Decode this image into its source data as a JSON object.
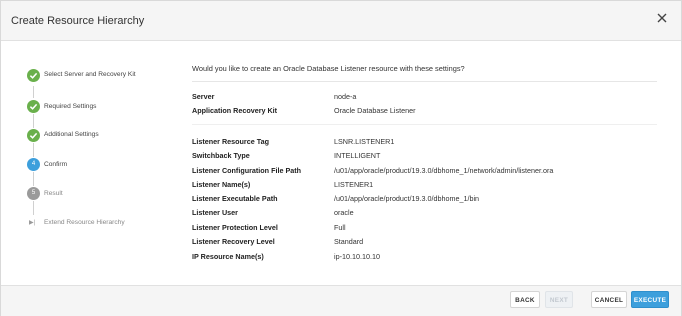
{
  "dialog": {
    "title": "Create Resource Hierarchy",
    "close_icon": "close-icon"
  },
  "steps": [
    {
      "label": "Select Server and Recovery Kit",
      "state": "done",
      "icon": "check-circle-icon"
    },
    {
      "label": "Required Settings",
      "state": "done",
      "icon": "check-circle-icon"
    },
    {
      "label": "Additional Settings",
      "state": "done",
      "icon": "check-circle-icon"
    },
    {
      "label": "Confirm",
      "state": "current",
      "number": "4",
      "icon": "step-number-icon"
    },
    {
      "label": "Result",
      "state": "pending",
      "number": "5",
      "icon": "step-number-icon"
    },
    {
      "label": "Extend Resource Hierarchy",
      "state": "pending",
      "icon": "arrow-icon",
      "arrow": "▶|"
    }
  ],
  "content": {
    "question": "Would you like to create an Oracle Database Listener resource with these settings?",
    "summary": [
      {
        "key": "Server",
        "value": "node-a"
      },
      {
        "key": "Application Recovery Kit",
        "value": "Oracle Database Listener"
      }
    ],
    "settings": [
      {
        "key": "Listener Resource Tag",
        "value": "LSNR.LISTENER1"
      },
      {
        "key": "Switchback Type",
        "value": "INTELLIGENT"
      },
      {
        "key": "Listener Configuration File Path",
        "value": "/u01/app/oracle/product/19.3.0/dbhome_1/network/admin/listener.ora"
      },
      {
        "key": "Listener Name(s)",
        "value": "LISTENER1"
      },
      {
        "key": "Listener Executable Path",
        "value": "/u01/app/oracle/product/19.3.0/dbhome_1/bin"
      },
      {
        "key": "Listener User",
        "value": "oracle"
      },
      {
        "key": "Listener Protection Level",
        "value": "Full"
      },
      {
        "key": "Listener Recovery Level",
        "value": "Standard"
      },
      {
        "key": "IP Resource Name(s)",
        "value": "ip-10.10.10.10"
      }
    ]
  },
  "footer": {
    "back": "BACK",
    "next": "NEXT",
    "cancel": "CANCEL",
    "execute": "EXECUTE"
  },
  "colors": {
    "done": "#6ab04c",
    "current": "#3d9fdc",
    "pending": "#9a9a9a",
    "primary_button": "#3d9fdc"
  }
}
